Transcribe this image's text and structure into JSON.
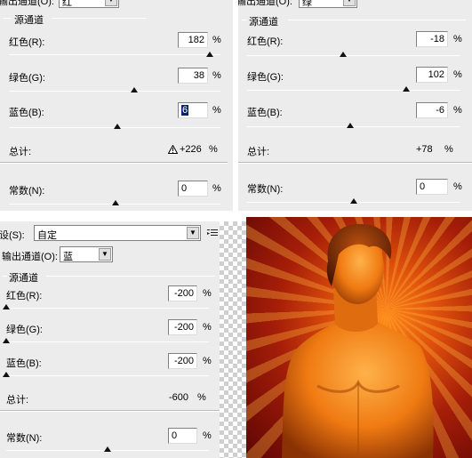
{
  "panel_a": {
    "output_channel_label": "输出通道(O):",
    "output_channel_value": "红",
    "source_group": "源通道",
    "red_label": "红色(R):",
    "red_value": "182",
    "green_label": "绿色(G):",
    "green_value": "38",
    "blue_label": "蓝色(B):",
    "blue_value": "6",
    "total_label": "总计:",
    "total_value": "+226",
    "constant_label": "常数(N):",
    "constant_value": "0",
    "percent": "%",
    "slider_levels": {
      "red": 182,
      "green": 38,
      "blue": 6,
      "constant": 0
    },
    "warning_icon": "warning-triangle-icon"
  },
  "panel_b": {
    "output_channel_label": "输出通道(O):",
    "output_channel_value": "绿",
    "source_group": "源通道",
    "red_label": "红色(R):",
    "red_value": "-18",
    "green_label": "绿色(G):",
    "green_value": "102",
    "blue_label": "蓝色(B):",
    "blue_value": "-6",
    "total_label": "总计:",
    "total_value": "+78",
    "constant_label": "常数(N):",
    "constant_value": "0",
    "percent": "%",
    "slider_levels": {
      "red": -18,
      "green": 102,
      "blue": -6,
      "constant": 0
    }
  },
  "panel_c": {
    "preset_label": "预设(S):",
    "preset_value": "自定",
    "output_channel_label": "输出通道(O):",
    "output_channel_value": "蓝",
    "source_group": "源通道",
    "red_label": "红色(R):",
    "red_value": "-200",
    "green_label": "绿色(G):",
    "green_value": "-200",
    "blue_label": "蓝色(B):",
    "blue_value": "-200",
    "total_label": "总计:",
    "total_value": "-600",
    "constant_label": "常数(N):",
    "constant_value": "0",
    "percent": "%",
    "slider_levels": {
      "red": -200,
      "green": -200,
      "blue": -200,
      "constant": 0
    },
    "preset_menu_icon": "menu-lines-icon"
  },
  "colors": {
    "panel_bg": "#ececec",
    "selection": "#0a246a",
    "photo_red": "#a61e08",
    "photo_orange": "#ff8a1a"
  }
}
